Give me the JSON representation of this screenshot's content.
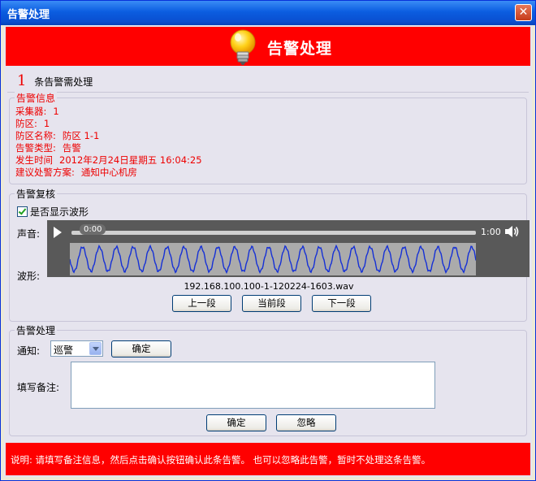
{
  "window": {
    "title": "告警处理",
    "close_glyph": "✕"
  },
  "banner": {
    "title": "告警处理",
    "icon": "lightbulb-icon",
    "bg_color": "#ff0000"
  },
  "alarm_count": {
    "number": "1",
    "label": "条告警需处理"
  },
  "alarm_info": {
    "title": "告警信息",
    "rows": [
      {
        "key": "采集器:",
        "value": "1"
      },
      {
        "key": "防区:",
        "value": "1"
      },
      {
        "key": "防区名称:",
        "value": "防区 1-1"
      },
      {
        "key": "告警类型:",
        "value": "告警"
      },
      {
        "key": "发生时间",
        "value": "2012年2月24日星期五 16:04:25"
      },
      {
        "key": "建议处警方案:",
        "value": "通知中心机房"
      }
    ]
  },
  "alarm_review": {
    "title": "告警复核",
    "show_waveform_label": "是否显示波形",
    "show_waveform_checked": true,
    "sound_label": "声音:",
    "waveform_label": "波形:",
    "player": {
      "current_time": "0:00",
      "duration": "1:00",
      "progress": 0
    },
    "filename": "192.168.100.100-1-120224-1603.wav",
    "buttons": {
      "prev": "上一段",
      "current": "当前段",
      "next": "下一段"
    }
  },
  "alarm_handling": {
    "title": "告警处理",
    "notify_label": "通知:",
    "notify_selected": "巡警",
    "notify_ok": "确定",
    "remark_label": "填写备注:",
    "remark_value": "",
    "confirm": "确定",
    "ignore": "忽略"
  },
  "footer": {
    "text": "说明: 请填写备注信息，然后点击确认按钮确认此条告警。   也可以忽略此告警，暂时不处理这条告警。"
  }
}
